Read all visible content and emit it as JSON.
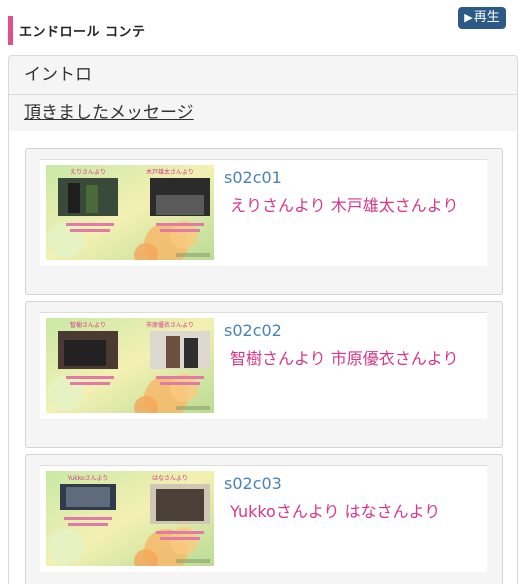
{
  "header": {
    "title": "エンドロール コンテ",
    "play_label": "再生"
  },
  "accordion": [
    {
      "label": "イントロ"
    },
    {
      "label": "頂きましたメッセージ"
    }
  ],
  "messages": [
    {
      "code": "s02c01",
      "caption": "えりさんより 木戸雄太さんより",
      "thumb_left_label": "えりさんより",
      "thumb_right_label": "木戸雄太さんより"
    },
    {
      "code": "s02c02",
      "caption": "智樹さんより 市原優衣さんより",
      "thumb_left_label": "智樹さんより",
      "thumb_right_label": "市原優衣さんより"
    },
    {
      "code": "s02c03",
      "caption": "Yukkoさんより はなさんより",
      "thumb_left_label": "Yukkoさんより",
      "thumb_right_label": "はなさんより"
    }
  ],
  "colors": {
    "accent_bar": "#e0508a",
    "play_button": "#2a5a85",
    "code_text": "#4a83b5",
    "caption_text": "#d8368a"
  }
}
